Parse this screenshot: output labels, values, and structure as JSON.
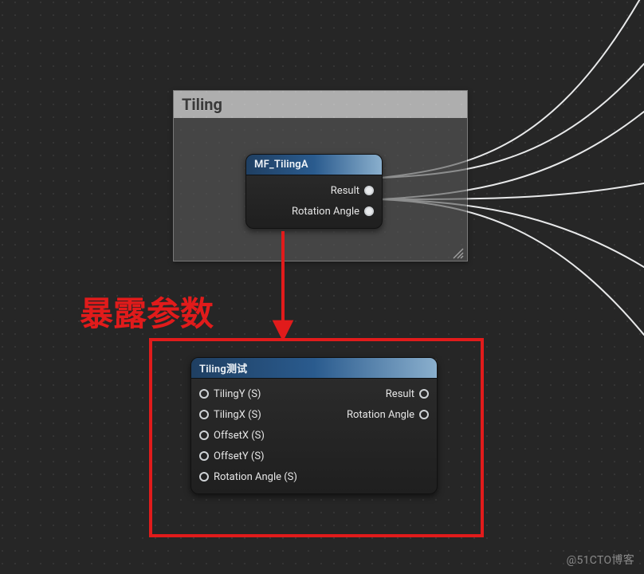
{
  "group": {
    "title": "Tiling"
  },
  "node_top": {
    "title": "MF_TilingA",
    "outputs": [
      "Result",
      "Rotation Angle"
    ]
  },
  "annotation": {
    "text": "暴露参数"
  },
  "node_bottom": {
    "title": "Tiling测试",
    "inputs": [
      "TilingY (S)",
      "TilingX (S)",
      "OffsetX (S)",
      "OffsetY (S)",
      "Rotation Angle (S)"
    ],
    "outputs": [
      "Result",
      "Rotation Angle"
    ]
  },
  "watermark": "@51CTO博客"
}
